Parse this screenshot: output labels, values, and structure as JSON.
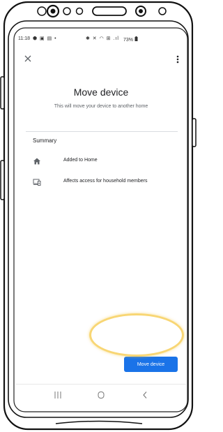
{
  "status_bar": {
    "time": "11:18",
    "left_icons": "⬢ ▣ ▤ •",
    "right_icons": "✱ ✕ ◠ ⊞ .ıl",
    "battery": "73%"
  },
  "dialog": {
    "title": "Move device",
    "subtitle": "This will move your device to another home"
  },
  "summary": {
    "heading": "Summary",
    "items": [
      {
        "icon": "home-icon",
        "label": "Added to Home"
      },
      {
        "icon": "devices-icon",
        "label": "Affects access for household members"
      }
    ]
  },
  "actions": {
    "move_label": "Move device",
    "button_color": "#1a73e8"
  },
  "icons": {
    "close": "close-icon",
    "more": "more-vert-icon",
    "nav": [
      "recent-apps-icon",
      "home-circle-icon",
      "back-icon"
    ]
  }
}
